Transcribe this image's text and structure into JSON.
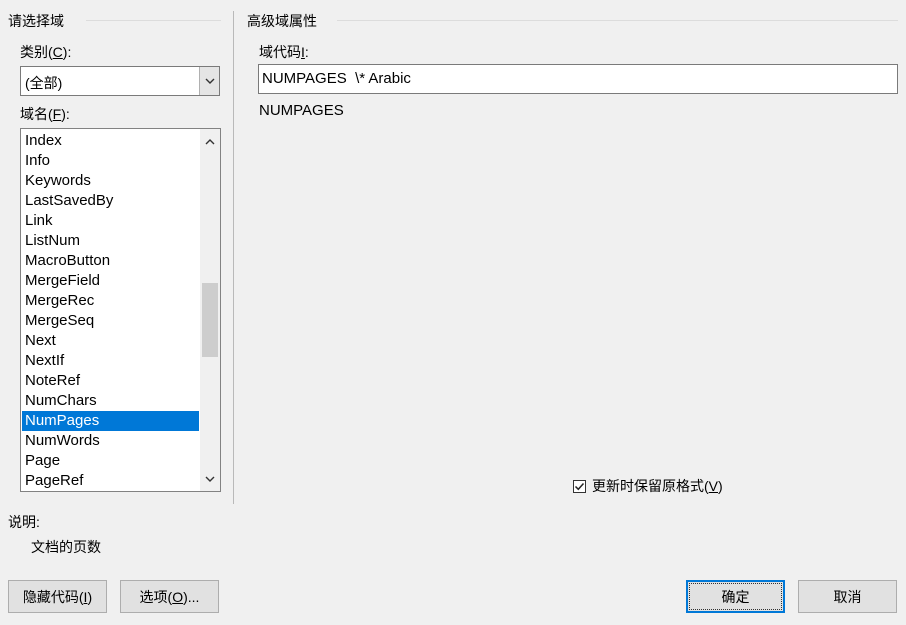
{
  "left_panel": {
    "group_title": "请选择域",
    "category_label_prefix": "类别(",
    "category_label_key": "C",
    "category_label_suffix": "):",
    "category_value": "(全部)",
    "field_names_label_prefix": "域名(",
    "field_names_label_key": "F",
    "field_names_label_suffix": "):",
    "field_names": [
      "Index",
      "Info",
      "Keywords",
      "LastSavedBy",
      "Link",
      "ListNum",
      "MacroButton",
      "MergeField",
      "MergeRec",
      "MergeSeq",
      "Next",
      "NextIf",
      "NoteRef",
      "NumChars",
      "NumPages",
      "NumWords",
      "Page",
      "PageRef"
    ],
    "selected_field": "NumPages"
  },
  "right_panel": {
    "group_title": "高级域属性",
    "field_codes_label_prefix": "域代码",
    "field_codes_label_key": "I",
    "field_codes_label_suffix": ":",
    "field_code_value": "NUMPAGES  \\* Arabic",
    "field_syntax": "NUMPAGES",
    "preserve_format_checked": true,
    "preserve_format_label_prefix": "更新时保留原格式(",
    "preserve_format_label_key": "V",
    "preserve_format_label_suffix": ")"
  },
  "description": {
    "label": "说明:",
    "text": "文档的页数"
  },
  "buttons": {
    "hide_codes_prefix": "隐藏代码(",
    "hide_codes_key": "I",
    "hide_codes_suffix": ")",
    "options_prefix": "选项(",
    "options_key": "O",
    "options_suffix": ")...",
    "ok": "确定",
    "cancel": "取消"
  },
  "colors": {
    "selection": "#0078d7",
    "background": "#f0f0f0"
  }
}
